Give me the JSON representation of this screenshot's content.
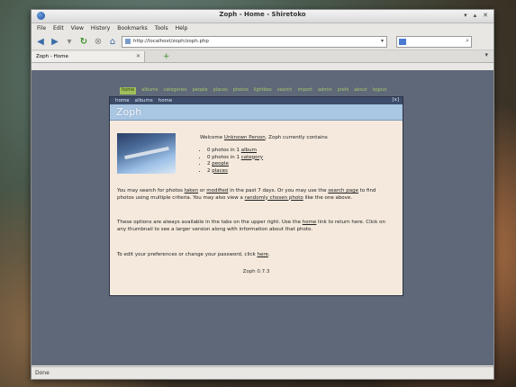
{
  "window": {
    "title": "Zoph - Home - Shiretoko"
  },
  "menubar": [
    "File",
    "Edit",
    "View",
    "History",
    "Bookmarks",
    "Tools",
    "Help"
  ],
  "navbar": {
    "url": "http://localhost/zoph/zoph.php"
  },
  "tabs": [
    {
      "label": "Zoph - Home"
    }
  ],
  "zoph": {
    "topmenu": [
      "home",
      "albums",
      "categories",
      "people",
      "places",
      "photos",
      "lightbox",
      "search",
      "import",
      "admin",
      "prefs",
      "about",
      "logout"
    ],
    "breadcrumb": [
      "home",
      "albums",
      "home"
    ],
    "breadcrumb_right": "[x]",
    "title": "Zoph",
    "welcome_pre": "Welcome ",
    "welcome_user": "Unknown Person",
    "welcome_post": ". Zoph currently contains",
    "stats": [
      {
        "pre": "0 photos in 1 ",
        "link": "album"
      },
      {
        "pre": "0 photos in 1 ",
        "link": "category"
      },
      {
        "pre": "2 ",
        "link": "people"
      },
      {
        "pre": "2 ",
        "link": "places"
      }
    ],
    "p1": {
      "a": "You may search for photos ",
      "b": "taken",
      "c": " or ",
      "d": "modified",
      "e": " in the past 7 days. Or you may use the ",
      "f": "search page",
      "g": " to find photos using multiple criteria. You may also view a ",
      "h": "randomly chosen photo",
      "i": " like the one above."
    },
    "p2": {
      "a": "These options are always available in the tabs on the upper right. Use the ",
      "b": "home",
      "c": " link to return here. Click on any thumbnail to see a larger version along with information about that photo."
    },
    "p3": {
      "a": "To edit your preferences or change your password, click ",
      "b": "here",
      "c": "."
    },
    "version": "Zoph 0.7.3"
  },
  "statusbar": {
    "text": "Done"
  }
}
